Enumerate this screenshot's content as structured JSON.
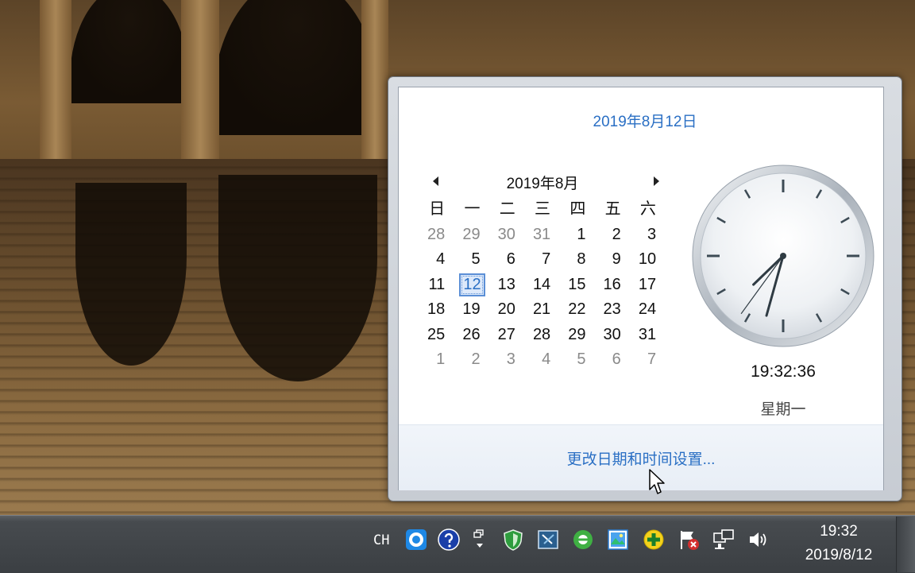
{
  "flyout": {
    "long_date": "2019年8月12日",
    "calendar": {
      "month_title": "2019年8月",
      "weekdays": [
        "日",
        "一",
        "二",
        "三",
        "四",
        "五",
        "六"
      ],
      "weeks": [
        [
          "28",
          "29",
          "30",
          "31",
          "1",
          "2",
          "3"
        ],
        [
          "4",
          "5",
          "6",
          "7",
          "8",
          "9",
          "10"
        ],
        [
          "11",
          "12",
          "13",
          "14",
          "15",
          "16",
          "17"
        ],
        [
          "18",
          "19",
          "20",
          "21",
          "22",
          "23",
          "24"
        ],
        [
          "25",
          "26",
          "27",
          "28",
          "29",
          "30",
          "31"
        ],
        [
          "1",
          "2",
          "3",
          "4",
          "5",
          "6",
          "7"
        ]
      ],
      "today": "12"
    },
    "clock": {
      "time": "19:32:36",
      "weekday": "星期一"
    },
    "footer_link": "更改日期和时间设置..."
  },
  "taskbar": {
    "input_language": "CH",
    "tray_icons": [
      "ifly-icon",
      "help-icon",
      "expand-tray-icon",
      "shield-icon",
      "powershell-icon",
      "green-circle-icon",
      "image-app-icon",
      "plus-icon",
      "action-center-flag-icon",
      "network-icon",
      "volume-icon"
    ],
    "clock_time": "19:32",
    "clock_date": "2019/8/12"
  },
  "colors": {
    "link_blue": "#2a6fc4",
    "taskbar": "#3b3f43"
  }
}
